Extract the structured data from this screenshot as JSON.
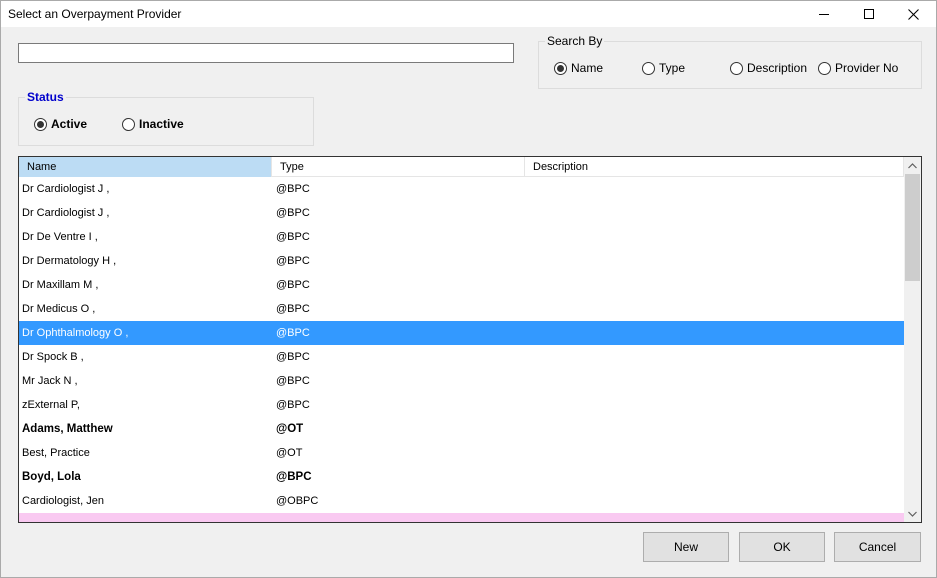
{
  "window": {
    "title": "Select an Overpayment Provider"
  },
  "search": {
    "value": "",
    "placeholder": ""
  },
  "search_by": {
    "legend": "Search By",
    "options": [
      {
        "label": "Name",
        "selected": true
      },
      {
        "label": "Type",
        "selected": false
      },
      {
        "label": "Description",
        "selected": false
      },
      {
        "label": "Provider No",
        "selected": false
      }
    ]
  },
  "status": {
    "legend": "Status",
    "legend_color": "#0000cc",
    "options": [
      {
        "label": "Active",
        "selected": true
      },
      {
        "label": "Inactive",
        "selected": false
      }
    ]
  },
  "grid": {
    "columns": [
      "Name",
      "Type",
      "Description"
    ],
    "sorted_column": "Name",
    "selected_row_color": "#3399ff",
    "rows": [
      {
        "name": "Dr Cardiologist J ,",
        "type": "@BPC",
        "description": ""
      },
      {
        "name": "Dr Cardiologist J ,",
        "type": "@BPC",
        "description": ""
      },
      {
        "name": "Dr De Ventre I ,",
        "type": "@BPC",
        "description": ""
      },
      {
        "name": "Dr Dermatology H ,",
        "type": "@BPC",
        "description": ""
      },
      {
        "name": "Dr Maxillam M ,",
        "type": "@BPC",
        "description": ""
      },
      {
        "name": "Dr Medicus O ,",
        "type": "@BPC",
        "description": ""
      },
      {
        "name": "Dr Ophthalmology O ,",
        "type": "@BPC",
        "description": "",
        "selected": true
      },
      {
        "name": "Dr Spock B ,",
        "type": "@BPC",
        "description": ""
      },
      {
        "name": "Mr Jack N ,",
        "type": "@BPC",
        "description": ""
      },
      {
        "name": "zExternal P,",
        "type": "@BPC",
        "description": ""
      },
      {
        "name": "Adams, Matthew",
        "type": "@OT",
        "description": "",
        "bold": true
      },
      {
        "name": "Best, Practice",
        "type": "@OT",
        "description": ""
      },
      {
        "name": "Boyd, Lola",
        "type": "@BPC",
        "description": "",
        "bold": true
      },
      {
        "name": "Cardiologist, Jen",
        "type": "@OBPC",
        "description": ""
      },
      {
        "name": "",
        "type": "",
        "description": "",
        "pink": true
      }
    ]
  },
  "buttons": {
    "new_label": "New",
    "ok_label": "OK",
    "cancel_label": "Cancel"
  }
}
